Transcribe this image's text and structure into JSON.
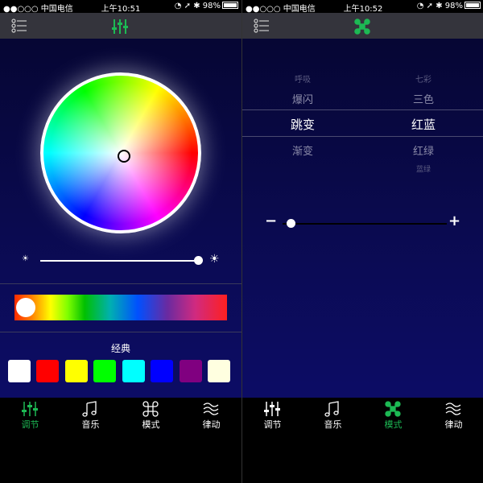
{
  "left_screen": {
    "status": {
      "carrier": "●●○○○ 中国电信",
      "time": "上午10:51",
      "battery": "98%"
    },
    "navbar": {
      "menu_icon": "list-icon",
      "center_icon": "sliders-icon"
    },
    "color_wheel": {
      "selected": "center"
    },
    "brightness": {
      "value_percent": 100
    },
    "spectrum": {
      "position_percent": 0
    },
    "classic_label": "经典",
    "swatches": [
      {
        "color": "#ffffff"
      },
      {
        "color": "#ff0000"
      },
      {
        "color": "#ffff00"
      },
      {
        "color": "#00ff00"
      },
      {
        "color": "#00ffff"
      },
      {
        "color": "#0000ff"
      },
      {
        "color": "#800080"
      },
      {
        "color": "#ffffe0"
      }
    ],
    "tabs": [
      {
        "label": "调节",
        "icon": "sliders-icon",
        "active": true
      },
      {
        "label": "音乐",
        "icon": "music-note-icon",
        "active": false
      },
      {
        "label": "模式",
        "icon": "command-icon",
        "active": false
      },
      {
        "label": "律动",
        "icon": "wave-icon",
        "active": false
      }
    ]
  },
  "right_screen": {
    "status": {
      "carrier": "●●○○○ 中国电信",
      "time": "上午10:52",
      "battery": "98%"
    },
    "navbar": {
      "menu_icon": "list-icon",
      "center_icon": "command-icon"
    },
    "picker": {
      "left_column": [
        "呼吸",
        "爆闪",
        "跳变",
        "渐变"
      ],
      "right_column": [
        "七彩",
        "三色",
        "红蓝",
        "红绿",
        "蓝绿"
      ],
      "selected_left": "跳变",
      "selected_right": "红蓝"
    },
    "speed": {
      "value_percent": 5
    },
    "tabs": [
      {
        "label": "调节",
        "icon": "sliders-icon",
        "active": false
      },
      {
        "label": "音乐",
        "icon": "music-note-icon",
        "active": false
      },
      {
        "label": "模式",
        "icon": "command-icon",
        "active": true
      },
      {
        "label": "律动",
        "icon": "wave-icon",
        "active": false
      }
    ]
  }
}
